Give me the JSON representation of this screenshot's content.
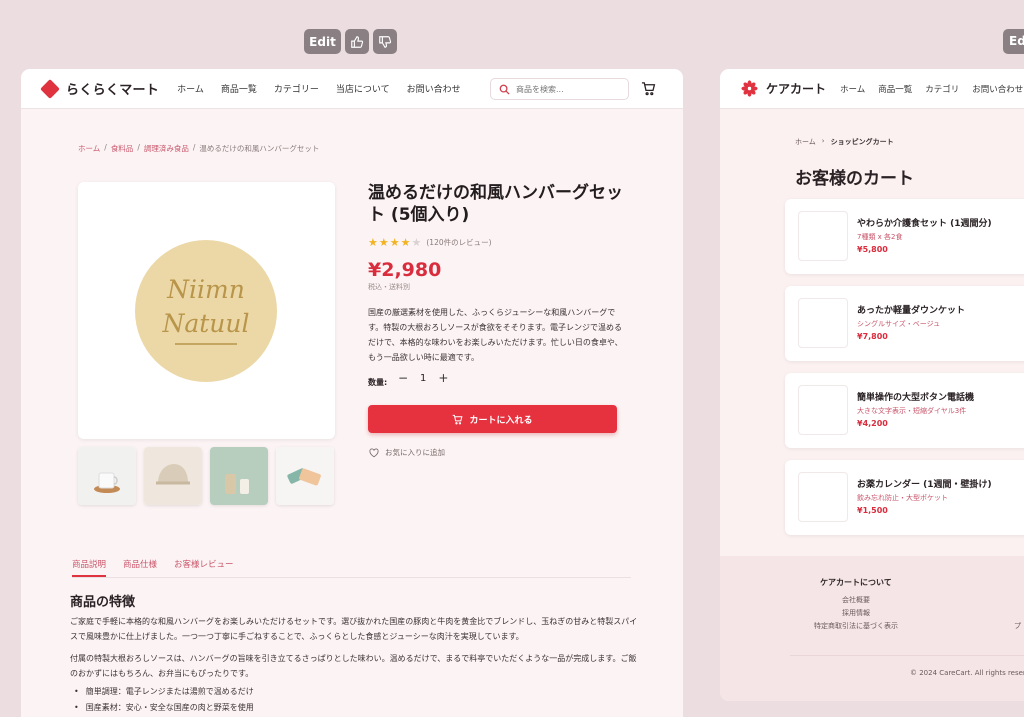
{
  "toolbar": {
    "edit_label": "Edit",
    "thumbs_up_icon": "thumbs-up-icon",
    "thumbs_down_icon": "thumbs-down-icon",
    "edit_right_label": "Ed"
  },
  "left": {
    "logo": "らくらくマート",
    "nav": [
      "ホーム",
      "商品一覧",
      "カテゴリー",
      "当店について",
      "お問い合わせ"
    ],
    "search_placeholder": "商品を検索...",
    "breadcrumb": [
      "ホーム",
      "食料品",
      "調理済み食品",
      "温めるだけの和風ハンバーグセット"
    ],
    "product": {
      "title": "温めるだけの和風ハンバーグセット (5個入り)",
      "rating": 4,
      "rating_max": 5,
      "reviews": "(120件のレビュー)",
      "price": "¥2,980",
      "tax": "税込・送料別",
      "description": "国産の厳選素材を使用した、ふっくらジューシーな和風ハンバーグです。特製の大根おろしソースが食欲をそそります。電子レンジで温めるだけで、本格的な味わいをお楽しみいただけます。忙しい日の食卓や、もう一品欲しい時に最適です。",
      "qty_label": "数量:",
      "qty": "1",
      "add_to_cart": "カートに入れる",
      "favorite": "お気に入りに追加",
      "logo_line1": "Niimn",
      "logo_line2": "Natuul"
    },
    "tabs": [
      "商品説明",
      "商品仕様",
      "お客様レビュー"
    ],
    "section_title": "商品の特徴",
    "paragraphs": [
      "ご家庭で手軽に本格的な和風ハンバーグをお楽しみいただけるセットです。選び抜かれた国産の豚肉と牛肉を黄金比でブレンドし、玉ねぎの甘みと特製スパイスで風味豊かに仕上げました。一つ一つ丁寧に手ごねすることで、ふっくらとした食感とジューシーな肉汁を実現しています。",
      "付属の特製大根おろしソースは、ハンバーグの旨味を引き立てるさっぱりとした味わい。温めるだけで、まるで料亭でいただくような一品が完成します。ご飯のおかずにはもちろん、お弁当にもぴったりです。"
    ],
    "bullets": [
      "簡単調理：電子レンジまたは湯煎で温めるだけ",
      "国産素材：安心・安全な国産の肉と野菜を使用"
    ]
  },
  "right": {
    "logo": "ケアカート",
    "nav": [
      "ホーム",
      "商品一覧",
      "カテゴリ",
      "お問い合わせ"
    ],
    "breadcrumb": [
      "ホーム",
      "ショッピングカート"
    ],
    "title": "お客様のカート",
    "items": [
      {
        "name": "やわらか介護食セット (1週間分)",
        "sub": "7種類 x 各2食",
        "price": "¥5,800"
      },
      {
        "name": "あったか軽量ダウンケット",
        "sub": "シングルサイズ・ベージュ",
        "price": "¥7,800"
      },
      {
        "name": "簡単操作の大型ボタン電話機",
        "sub": "大きな文字表示・短縮ダイヤル3件",
        "price": "¥4,200"
      },
      {
        "name": "お薬カレンダー (1週間・壁掛け)",
        "sub": "飲み忘れ防止・大型ポケット",
        "price": "¥1,500"
      }
    ],
    "footer": {
      "heading": "ケアカートについて",
      "links": [
        "会社概要",
        "採用情報",
        "特定商取引法に基づく表示"
      ],
      "extra": "プ",
      "copyright": "© 2024 CareCart. All rights reserved."
    }
  }
}
